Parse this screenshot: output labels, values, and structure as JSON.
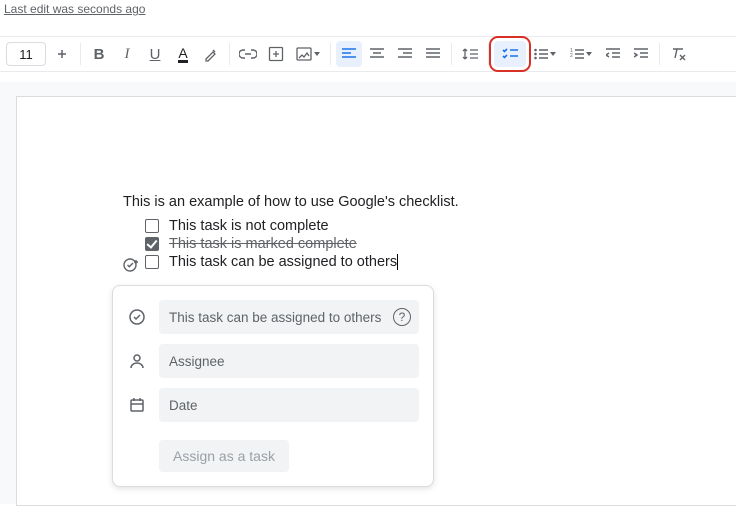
{
  "header": {
    "edit_status": "Last edit was seconds ago"
  },
  "toolbar": {
    "font_size": "11"
  },
  "doc": {
    "intro": "This is an example of how to use Google's checklist.",
    "items": [
      {
        "text": "This task is not complete",
        "checked": false
      },
      {
        "text": "This task is marked complete",
        "checked": true
      },
      {
        "text": "This task can be assigned to others",
        "checked": false,
        "assignable": true
      }
    ]
  },
  "task_popup": {
    "title_placeholder": "This task can be assigned to others",
    "assignee_placeholder": "Assignee",
    "date_placeholder": "Date",
    "submit_label": "Assign as a task"
  }
}
